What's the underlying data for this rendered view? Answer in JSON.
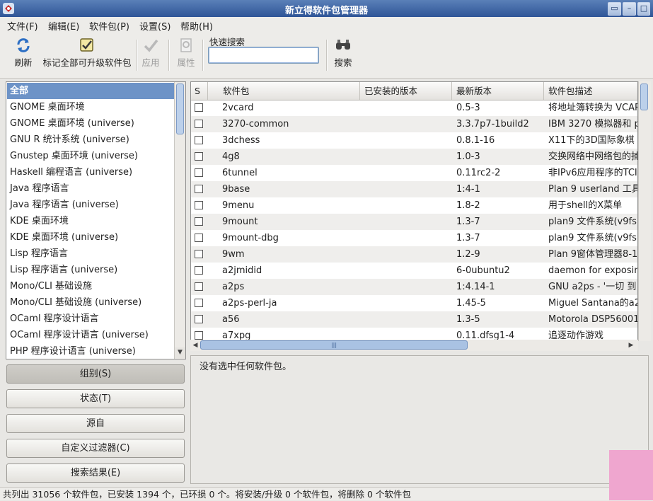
{
  "window": {
    "title": "新立得软件包管理器",
    "buttons": [
      "▭",
      "–",
      "□",
      "✕"
    ]
  },
  "menubar": [
    {
      "label": "文件(F)"
    },
    {
      "label": "编辑(E)"
    },
    {
      "label": "软件包(P)"
    },
    {
      "label": "设置(S)"
    },
    {
      "label": "帮助(H)"
    }
  ],
  "toolbar": {
    "refresh": "刷新",
    "mark_all": "标记全部可升级软件包",
    "apply": "应用",
    "properties": "属性",
    "quick_search_label": "快速搜索",
    "quick_search_value": "",
    "search": "搜索"
  },
  "categories": [
    "全部",
    "GNOME 桌面环境",
    "GNOME 桌面环境 (universe)",
    "GNU R 统计系统 (universe)",
    "Gnustep 桌面环境 (universe)",
    "Haskell 编程语言 (universe)",
    "Java 程序语言",
    "Java 程序语言 (universe)",
    "KDE 桌面环境",
    "KDE 桌面环境 (universe)",
    "Lisp 程序语言",
    "Lisp 程序语言 (universe)",
    "Mono/CLI 基础设施",
    "Mono/CLI 基础设施 (universe)",
    "OCaml 程序设计语言",
    "OCaml 程序设计语言 (universe)",
    "PHP 程序设计语言 (universe)"
  ],
  "side_buttons": [
    "组别(S)",
    "状态(T)",
    "源自",
    "自定义过滤器(C)",
    "搜索结果(E)"
  ],
  "table": {
    "columns": [
      "S",
      "软件包",
      "已安装的版本",
      "最新版本",
      "软件包描述"
    ],
    "rows": [
      {
        "name": "2vcard",
        "installed": "",
        "latest": "0.5-3",
        "desc": "将地址簿转换为 VCAR"
      },
      {
        "name": "3270-common",
        "installed": "",
        "latest": "3.3.7p7-1build2",
        "desc": "IBM 3270 模拟器和 p"
      },
      {
        "name": "3dchess",
        "installed": "",
        "latest": "0.8.1-16",
        "desc": "X11下的3D国际象棋"
      },
      {
        "name": "4g8",
        "installed": "",
        "latest": "1.0-3",
        "desc": "交换网络中网络包的捕"
      },
      {
        "name": "6tunnel",
        "installed": "",
        "latest": "0.11rc2-2",
        "desc": "非IPv6应用程序的TCI"
      },
      {
        "name": "9base",
        "installed": "",
        "latest": "1:4-1",
        "desc": "Plan 9 userland 工具"
      },
      {
        "name": "9menu",
        "installed": "",
        "latest": "1.8-2",
        "desc": "用于shell的X菜单"
      },
      {
        "name": "9mount",
        "installed": "",
        "latest": "1.3-7",
        "desc": "plan9 文件系统(v9fs"
      },
      {
        "name": "9mount-dbg",
        "installed": "",
        "latest": "1.3-7",
        "desc": "plan9 文件系统(v9fs"
      },
      {
        "name": "9wm",
        "installed": "",
        "latest": "1.2-9",
        "desc": "Plan 9窗体管理器8-1"
      },
      {
        "name": "a2jmidid",
        "installed": "",
        "latest": "6-0ubuntu2",
        "desc": "daemon for exposin"
      },
      {
        "name": "a2ps",
        "installed": "",
        "latest": "1:4.14-1",
        "desc": "GNU a2ps - '一切 到"
      },
      {
        "name": "a2ps-perl-ja",
        "installed": "",
        "latest": "1.45-5",
        "desc": "Miguel Santana的a2"
      },
      {
        "name": "a56",
        "installed": "",
        "latest": "1.3-5",
        "desc": "Motorola DSP56001"
      },
      {
        "name": "a7xpg",
        "installed": "",
        "latest": "0.11.dfsg1-4",
        "desc": "追逐动作游戏"
      }
    ]
  },
  "details_text": "没有选中任何软件包。",
  "status_text": "共列出 31056 个软件包，已安装 1394 个，已环损 0 个。将安装/升级 0 个软件包，将删除 0 个软件包",
  "colors": {
    "titlebar": "#2f5597",
    "selection": "#6d93c7",
    "scroll_thumb": "#a9c2e3"
  }
}
